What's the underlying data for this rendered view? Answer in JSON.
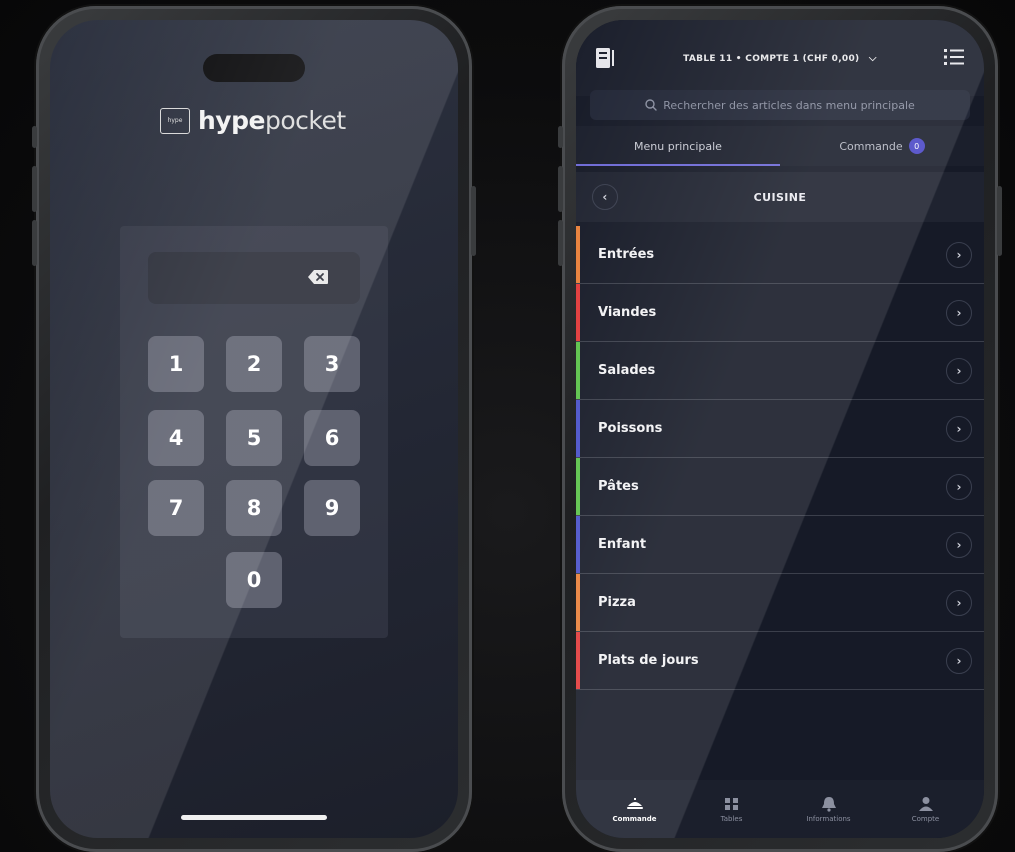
{
  "login": {
    "brand_box": "hype",
    "brand_bold": "hype",
    "brand_light": "pocket",
    "keys": [
      "1",
      "2",
      "3",
      "4",
      "5",
      "6",
      "7",
      "8",
      "9",
      "0"
    ]
  },
  "menu": {
    "header_title": "TABLE 11 • COMPTE 1 (CHF 0,00)",
    "search_placeholder": "Rechercher des articles dans menu principale",
    "tabs": [
      {
        "label": "Menu principale"
      },
      {
        "label": "Commande",
        "badge": "0"
      }
    ],
    "section_title": "CUISINE",
    "categories": [
      {
        "label": "Entrées",
        "color": "#e8803a"
      },
      {
        "label": "Viandes",
        "color": "#e23a3a"
      },
      {
        "label": "Salades",
        "color": "#5cc24a"
      },
      {
        "label": "Poissons",
        "color": "#4a52c9"
      },
      {
        "label": "Pâtes",
        "color": "#5cc24a"
      },
      {
        "label": "Enfant",
        "color": "#4a52c9"
      },
      {
        "label": "Pizza",
        "color": "#e8803a"
      },
      {
        "label": "Plats de jours",
        "color": "#e23a3a"
      }
    ],
    "bottom_nav": [
      {
        "label": "Commande",
        "icon": "dish-icon"
      },
      {
        "label": "Tables",
        "icon": "tables-icon"
      },
      {
        "label": "Informations",
        "icon": "bell-icon"
      },
      {
        "label": "Compte",
        "icon": "user-icon"
      }
    ]
  }
}
